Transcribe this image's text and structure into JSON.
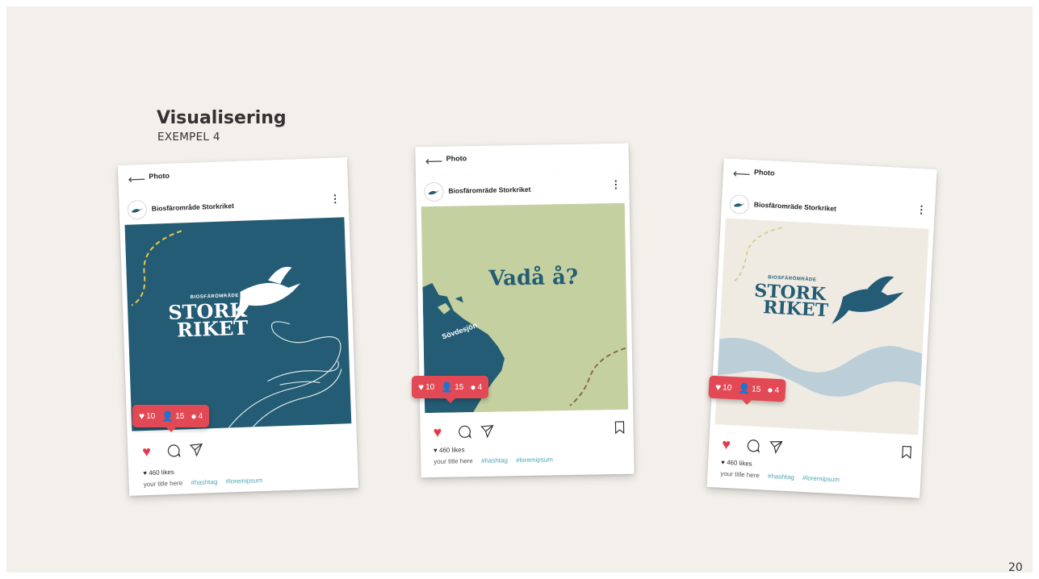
{
  "slide": {
    "heading": "Visualisering",
    "subheading": "EXEMPEL 4",
    "page_number": "20"
  },
  "posts": [
    {
      "topbar_title": "Photo",
      "account_name": "Biosfärområde Storkriket",
      "likes": "460 likes",
      "title": "your title here",
      "hashtags": [
        "#hashtag",
        "#loremipsum"
      ],
      "badge": {
        "likes": "10",
        "followers": "15",
        "comments": "4"
      },
      "logo": {
        "small": "BIOSFÄRÖMRÅDE",
        "line1": "STORK",
        "line2": "RIKET"
      },
      "background": "#235c74"
    },
    {
      "topbar_title": "Photo",
      "account_name": "Biosfäromräde Storkriket",
      "likes": "460 likes",
      "title": "your title here",
      "hashtags": [
        "#hashtag",
        "#loremipsum"
      ],
      "badge": {
        "likes": "10",
        "followers": "15",
        "comments": "4"
      },
      "headline": "Vadå å?",
      "map_label": "Sövdesjön",
      "background": "#c4d0a0"
    },
    {
      "topbar_title": "Photo",
      "account_name": "Biosfäromräde Storkriket",
      "likes": "460 likes",
      "title": "your title here",
      "hashtags": [
        "#hashtag",
        "#loremipsum"
      ],
      "badge": {
        "likes": "10",
        "followers": "15",
        "comments": "4"
      },
      "logo": {
        "small": "BIOSFÄRÖMRÅDE",
        "line1": "STORK",
        "line2": "RIKET"
      },
      "background": "#efebe3"
    }
  ],
  "colors": {
    "accent_red": "#e24955",
    "brand_blue": "#235c74",
    "hashtag_teal": "#4aa6b8",
    "slide_bg": "#f3f0eb"
  }
}
